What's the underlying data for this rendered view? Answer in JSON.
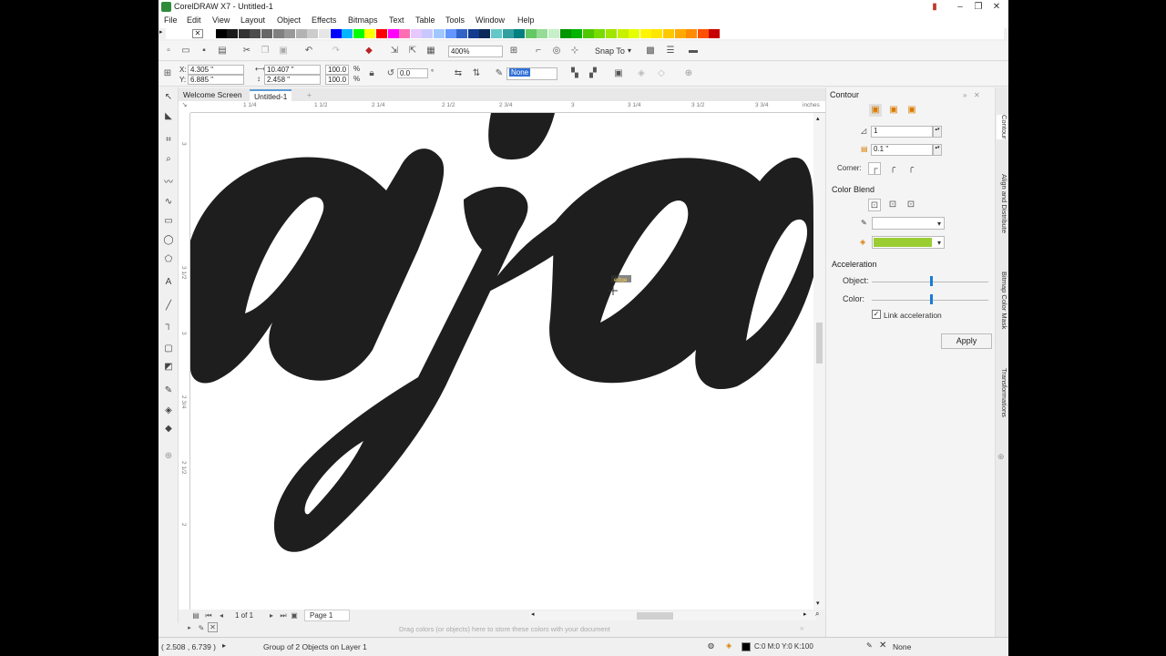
{
  "window": {
    "title": "CorelDRAW X7 - Untitled-1"
  },
  "menu": [
    "File",
    "Edit",
    "View",
    "Layout",
    "Object",
    "Effects",
    "Bitmaps",
    "Text",
    "Table",
    "Tools",
    "Window",
    "Help"
  ],
  "palette_colors": [
    "#ffffff",
    "#000000",
    "#1a1a1a",
    "#333333",
    "#4d4d4d",
    "#666666",
    "#808080",
    "#999999",
    "#b3b3b3",
    "#cccccc",
    "#e6e6e6",
    "#0000ff",
    "#00b4ff",
    "#00ff00",
    "#ffff00",
    "#ff0000",
    "#ff00ff",
    "#ff6eb4",
    "#e6c8ff",
    "#c8c8ff",
    "#a0c8ff",
    "#6496ff",
    "#3264c8",
    "#143c8c",
    "#0a285a",
    "#64c8c8",
    "#32a0a0",
    "#008080",
    "#64c864",
    "#96dc96",
    "#c8f0c8",
    "#009600",
    "#00b400",
    "#50c800",
    "#78dc00",
    "#a0e600",
    "#c8f000",
    "#e6ff00",
    "#fff500",
    "#ffe600",
    "#ffc800",
    "#ffaa00",
    "#ff8c00",
    "#ff5000",
    "#c80000"
  ],
  "standard_toolbar": {
    "zoom": "400%",
    "snap_to": "Snap To"
  },
  "property_bar": {
    "x": "4.305 \"",
    "y": "6.885 \"",
    "width": "10.407 \"",
    "height": "2.458 \"",
    "scale_x": "100.0",
    "scale_y": "100.0",
    "percent": "%",
    "rotation": "0.0",
    "degree": "°",
    "outline": "None"
  },
  "doc_tabs": [
    "Welcome Screen",
    "Untitled-1"
  ],
  "ruler": {
    "units": "inches",
    "labels": [
      "1 1/4",
      "1 1/2",
      "2 1/4",
      "2 1/2",
      "2 3/4",
      "3",
      "3 1/4",
      "3 1/2",
      "3 3/4"
    ],
    "v_labels": [
      "3",
      "3 1/2",
      "3",
      "2 3/4",
      "2 1/2",
      "2"
    ]
  },
  "canvas": {
    "cursor_hint": "edge"
  },
  "page_nav": {
    "pages": "1 of 1",
    "page_tab": "Page 1"
  },
  "color_tray": {
    "hint": "Drag colors (or objects) here to store these colors with your document"
  },
  "status": {
    "coords": "( 2.508 , 6.739 )",
    "selection": "Group of 2 Objects on Layer 1",
    "fill": "C:0 M:0 Y:0 K:100",
    "outline": "None"
  },
  "docker": {
    "title": "Contour",
    "steps": "1",
    "offset": "0.1 \"",
    "corner_label": "Corner:",
    "color_blend_title": "Color Blend",
    "fill_color": "#9acd32",
    "acceleration_title": "Acceleration",
    "object_label": "Object:",
    "color_label": "Color:",
    "object_accel": 0.5,
    "color_accel": 0.5,
    "link_label": "Link acceleration",
    "link_checked": true,
    "apply": "Apply"
  },
  "docker_tabs": [
    "Contour",
    "Align and Distribute",
    "Bitmap Color Mask",
    "Transformations"
  ]
}
